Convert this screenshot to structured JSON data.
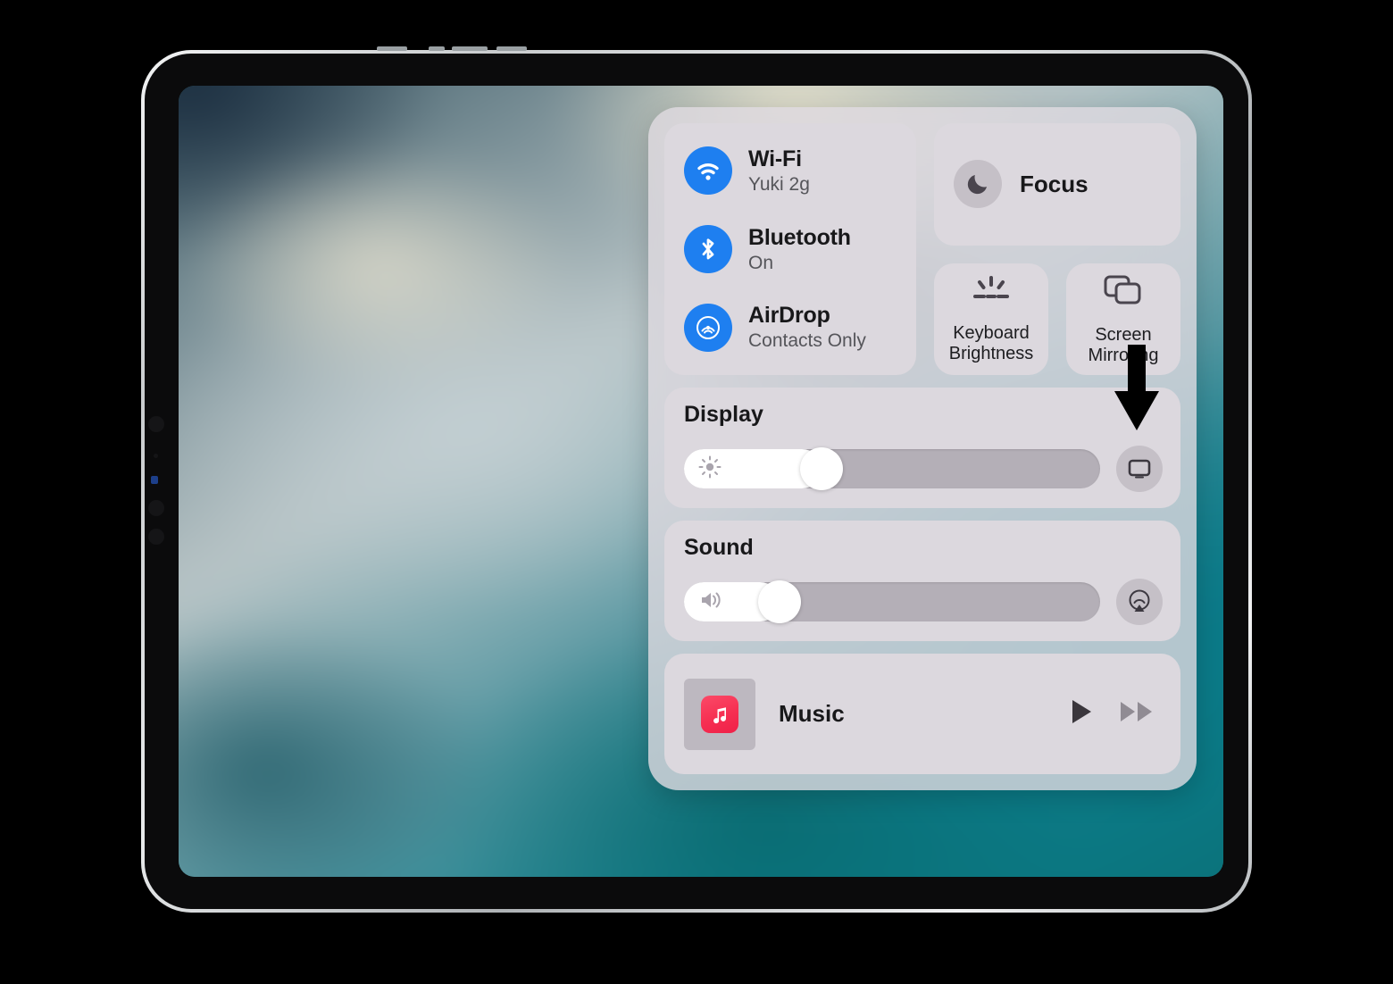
{
  "device": {
    "type": "tablet",
    "orientation": "landscape"
  },
  "control_center": {
    "connectivity": {
      "items": [
        {
          "icon": "wifi-icon",
          "title": "Wi-Fi",
          "subtitle": "Yuki 2g",
          "color": "#1e7ff0"
        },
        {
          "icon": "bluetooth-icon",
          "title": "Bluetooth",
          "subtitle": "On",
          "color": "#1e7ff0"
        },
        {
          "icon": "airdrop-icon",
          "title": "AirDrop",
          "subtitle": "Contacts Only",
          "color": "#1e7ff0"
        }
      ]
    },
    "focus": {
      "icon": "moon-icon",
      "label": "Focus"
    },
    "quick_tiles": [
      {
        "icon": "keyboard-brightness-icon",
        "label": "Keyboard\nBrightness",
        "line1": "Keyboard",
        "line2": "Brightness"
      },
      {
        "icon": "screen-mirroring-icon",
        "label": "Screen\nMirroring",
        "line1": "Screen",
        "line2": "Mirroring"
      }
    ],
    "display": {
      "label": "Display",
      "slider_icon": "brightness-icon",
      "value_percent": 33,
      "action_icon": "display-preferences-icon"
    },
    "sound": {
      "label": "Sound",
      "slider_icon": "speaker-icon",
      "value_percent": 23,
      "action_icon": "airplay-audio-icon"
    },
    "music": {
      "app_icon": "music-app-icon",
      "title": "Music",
      "play_icon": "play-icon",
      "next_icon": "fast-forward-icon"
    }
  },
  "annotation": {
    "arrow": "down-arrow-pointer",
    "points_at": "display-preferences-icon"
  },
  "colors": {
    "accent_blue": "#1e7ff0",
    "panel_bg": "#ded ade",
    "tile_bg": "#dcd8de",
    "track": "#b4afb7",
    "music_red": "#f62f52"
  }
}
